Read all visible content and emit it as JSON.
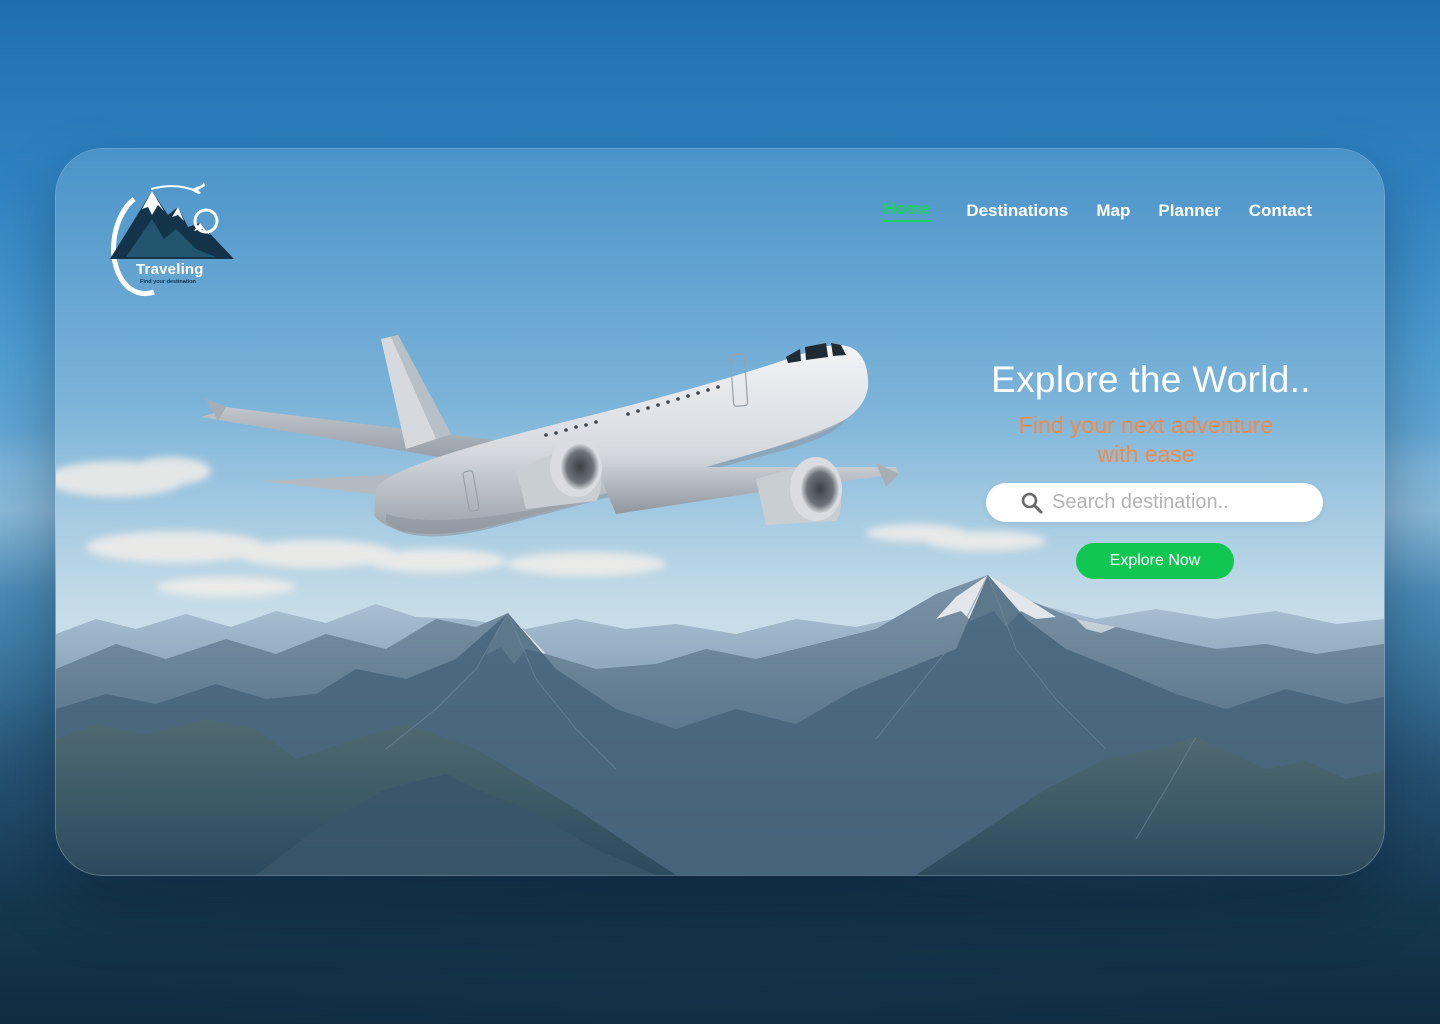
{
  "logo": {
    "title": "Traveling",
    "tagline": "Find your destination"
  },
  "nav": {
    "items": [
      {
        "label": "Home",
        "active": true
      },
      {
        "label": "Destinations",
        "active": false
      },
      {
        "label": "Map",
        "active": false
      },
      {
        "label": "Planner",
        "active": false
      },
      {
        "label": "Contact",
        "active": false
      }
    ]
  },
  "hero": {
    "title": "Explore the World..",
    "subtitle_line1": "Find your next adventure",
    "subtitle_line2": "with ease"
  },
  "search": {
    "placeholder": "Search destination..",
    "value": "",
    "icon": "search-icon"
  },
  "cta": {
    "label": "Explore Now"
  },
  "colors": {
    "accent_green": "#12c653",
    "active_nav": "#1fcf5e",
    "subtitle_orange": "#f08a4b",
    "logo_navy": "#12334a"
  }
}
